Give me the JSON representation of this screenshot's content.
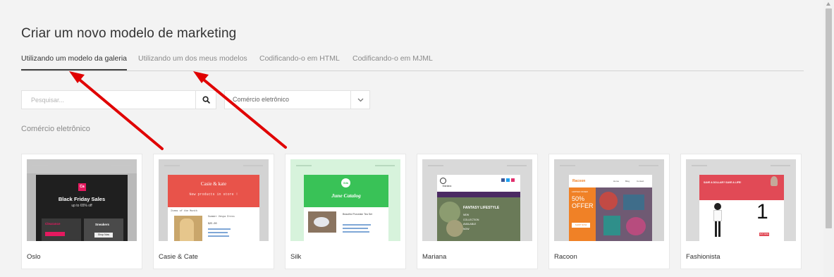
{
  "page": {
    "title": "Criar um novo modelo de marketing"
  },
  "tabs": [
    {
      "label": "Utilizando um modelo da galeria",
      "active": true
    },
    {
      "label": "Utilizando um dos meus modelos",
      "active": false
    },
    {
      "label": "Codificando-o em HTML",
      "active": false
    },
    {
      "label": "Codificando-o em MJML",
      "active": false
    }
  ],
  "search": {
    "placeholder": "Pesquisar...",
    "icon": "search-icon"
  },
  "category_select": {
    "value": "Comércio eletrônico",
    "icon": "chevron-down-icon"
  },
  "section": {
    "label": "Comércio eletrônico"
  },
  "templates": [
    {
      "name": "Oslo",
      "thumb": {
        "logo": "Ca",
        "headline": "Black Friday Sales",
        "subline": "up to 65% off",
        "left_tile": "Clearance",
        "right_tile": "Sneakers",
        "button": "Shop Now"
      }
    },
    {
      "name": "Casie & Cate",
      "thumb": {
        "logo": "Casie & kate",
        "banner_text": "New products in store !",
        "section": "Items of the Month",
        "product": "Summer Vespa Dress",
        "price": "$25.00"
      }
    },
    {
      "name": "Silk",
      "thumb": {
        "logo": "Silk",
        "headline": "June Catalog",
        "product": "Beautiful Porcelain Tea Set"
      }
    },
    {
      "name": "Mariana",
      "thumb": {
        "logo": "Mariana",
        "headline": "FANTASY LIFESTYLE",
        "list": [
          "NEW",
          "COLLECTION",
          "AVAILABLE",
          "NOW"
        ]
      }
    },
    {
      "name": "Racoon",
      "thumb": {
        "logo": "Racoon",
        "nav": [
          "Home",
          "Blog",
          "Contact"
        ],
        "tag": "LIMITED OFFER",
        "offer_big": "50%",
        "offer_word": "OFFER",
        "button": "SHOP NOW"
      }
    },
    {
      "name": "Fashionista",
      "thumb": {
        "tagline": "SAVE A DOLLAR? SAVE A LIFE!",
        "number": "1",
        "button": "BUY NOW"
      }
    }
  ],
  "colors": {
    "arrow": "#e00000",
    "oslo_accent": "#e5195f",
    "casie_banner": "#e8534a",
    "silk_banner": "#39c257",
    "silk_background": "#d7f3dc",
    "mariana_purple": "#4b2a63",
    "racoon_orange": "#f08126",
    "fashionista_red": "#e14a56"
  }
}
